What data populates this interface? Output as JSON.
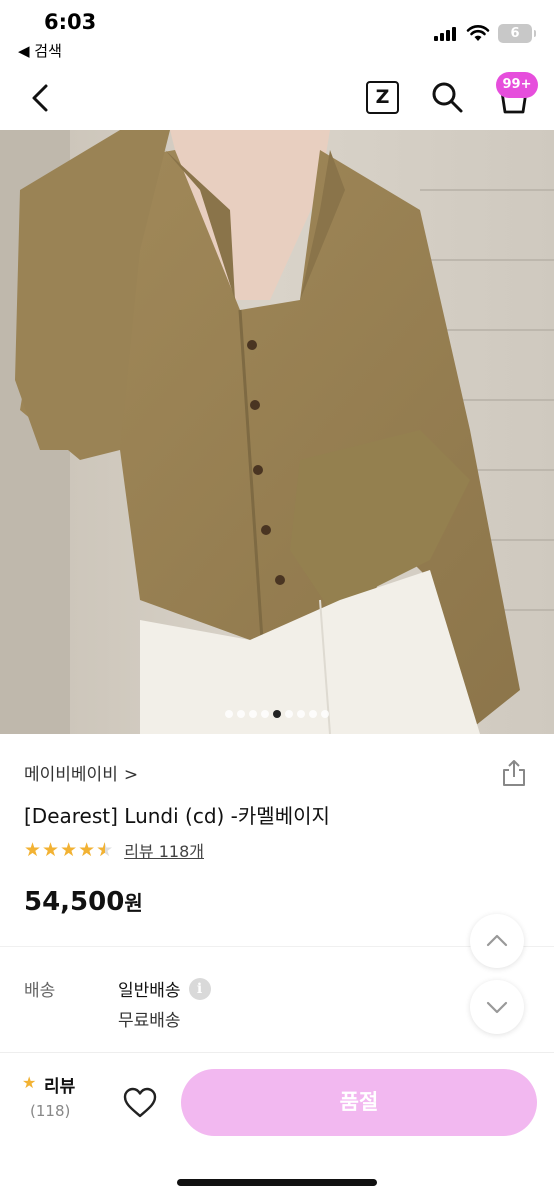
{
  "status": {
    "time": "6:03",
    "back_app": "◀ 검색",
    "battery": "6"
  },
  "nav": {
    "z_label": "Z",
    "cart_badge": "99+"
  },
  "gallery": {
    "total": 9,
    "active_index": 4
  },
  "product": {
    "brand": "메이비베이비",
    "brand_chevron": ">",
    "title": "[Dearest] Lundi (cd) -카멜베이지",
    "rating": 4.5,
    "review_text": "리뷰 118개",
    "price": "54,500",
    "price_unit": "원"
  },
  "shipping": {
    "label": "배송",
    "type": "일반배송",
    "info_icon": "i",
    "fee": "무료배송"
  },
  "bottom": {
    "review_label": "리뷰",
    "review_count": "(118)",
    "buy_label": "품절"
  },
  "colors": {
    "badge": "#e64edc",
    "buy_button": "#f2b8f0",
    "star": "#f2b233"
  }
}
